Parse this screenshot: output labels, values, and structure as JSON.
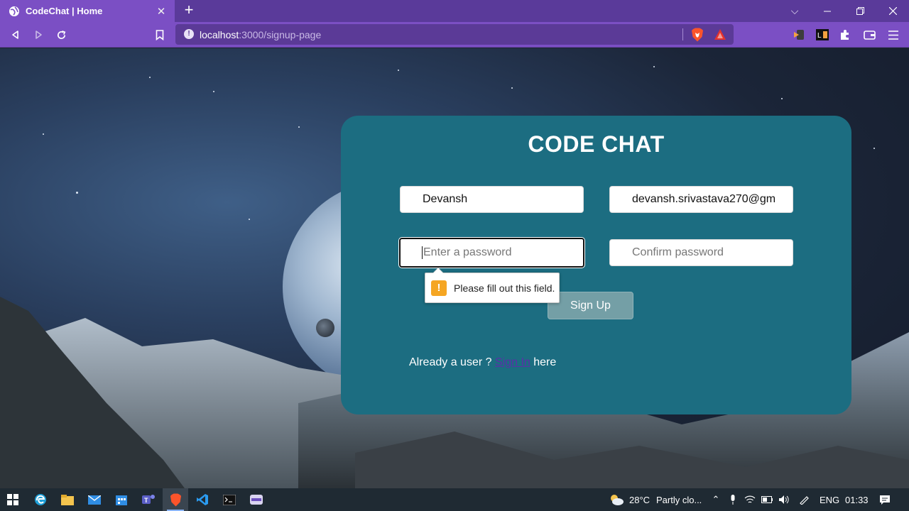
{
  "browser": {
    "tab_title": "CodeChat | Home",
    "new_tab": "+",
    "url_host": "localhost",
    "url_path": ":3000/signup-page"
  },
  "page": {
    "title": "CODE CHAT",
    "fields": {
      "name": {
        "value": "Devansh"
      },
      "email": {
        "value": "devansh.srivastava270@gm"
      },
      "password": {
        "placeholder": "Enter a password"
      },
      "confirm": {
        "placeholder": "Confirm password"
      }
    },
    "validation_message": "Please fill out this field.",
    "signup_label": "Sign Up",
    "already_prefix": "Already a user ?",
    "signin_link": "Sign In",
    "already_suffix": "here"
  },
  "taskbar": {
    "weather_temp": "28°C",
    "weather_desc": "Partly clo...",
    "lang": "ENG",
    "time": "01:33"
  },
  "colors": {
    "card": "#1c6d81",
    "chrome": "#7b4fc4",
    "button": "#749fa6"
  }
}
